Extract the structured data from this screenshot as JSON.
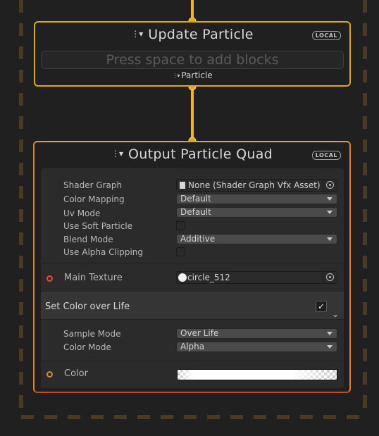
{
  "update_context": {
    "title": "Update Particle",
    "badge": "LOCAL",
    "placeholder": "Press space to add blocks",
    "flow_label": "Particle"
  },
  "output_context": {
    "title": "Output Particle Quad",
    "badge": "LOCAL",
    "properties": {
      "shader_graph": {
        "label": "Shader Graph",
        "value": "None (Shader Graph Vfx Asset)"
      },
      "color_mapping": {
        "label": "Color Mapping",
        "value": "Default"
      },
      "uv_mode": {
        "label": "Uv Mode",
        "value": "Default"
      },
      "use_soft_particle": {
        "label": "Use Soft Particle",
        "checked": false
      },
      "blend_mode": {
        "label": "Blend Mode",
        "value": "Additive"
      },
      "use_alpha_clipping": {
        "label": "Use Alpha Clipping",
        "checked": false
      },
      "main_texture": {
        "label": "Main Texture",
        "value": "circle_512"
      }
    },
    "block": {
      "title": "Set Color over Life",
      "enabled": true,
      "sample_mode": {
        "label": "Sample Mode",
        "value": "Over Life"
      },
      "color_mode": {
        "label": "Color Mode",
        "value": "Alpha"
      },
      "color": {
        "label": "Color"
      }
    }
  },
  "colors": {
    "flow_edge": "#f1b51c",
    "update_border": "#e3a51b",
    "output_border_top": "#e9a123",
    "output_border_bottom": "#c24a2a",
    "system_dash": "#4a3a24",
    "port_red": "#e0503a",
    "port_orange": "#d9873a"
  },
  "icons": {
    "particle": "particle-icon",
    "file": "file-icon",
    "object_picker": "object-picker-icon",
    "checkmark": "checkmark-icon",
    "chevron": "chevron-down-icon",
    "texture": "white-circle-icon"
  }
}
